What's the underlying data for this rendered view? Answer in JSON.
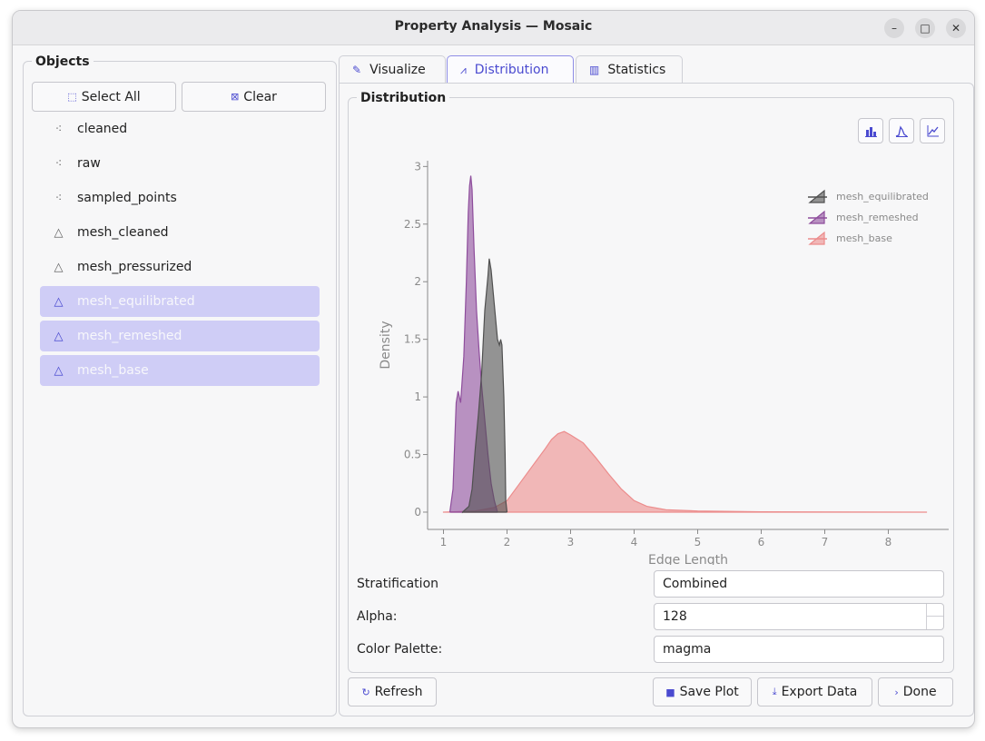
{
  "window": {
    "title": "Property Analysis — Mosaic",
    "controls": [
      "–",
      "□",
      "✕"
    ]
  },
  "objects_panel": {
    "title": "Objects",
    "select_all_label": "Select All",
    "clear_label": "Clear",
    "items": [
      {
        "label": "cleaned",
        "icon": "point-cloud-icon",
        "selected": false
      },
      {
        "label": "raw",
        "icon": "point-cloud-icon",
        "selected": false
      },
      {
        "label": "sampled_points",
        "icon": "point-cloud-icon",
        "selected": false
      },
      {
        "label": "mesh_cleaned",
        "icon": "triangle-mesh-icon",
        "selected": false
      },
      {
        "label": "mesh_pressurized",
        "icon": "triangle-mesh-icon",
        "selected": false
      },
      {
        "label": "mesh_equilibrated",
        "icon": "triangle-mesh-icon",
        "selected": true
      },
      {
        "label": "mesh_remeshed",
        "icon": "triangle-mesh-icon",
        "selected": true
      },
      {
        "label": "mesh_base",
        "icon": "triangle-mesh-icon",
        "selected": true
      }
    ]
  },
  "tabs": [
    {
      "label": "Visualize",
      "icon": "brush-icon",
      "active": false
    },
    {
      "label": "Distribution",
      "icon": "distribution-icon",
      "active": true
    },
    {
      "label": "Statistics",
      "icon": "bar-chart-icon",
      "active": false
    }
  ],
  "distribution_group": {
    "title": "Distribution",
    "tools": [
      "histogram-icon",
      "density-icon",
      "line-plot-icon"
    ]
  },
  "chart_data": {
    "type": "area",
    "xlabel": "Edge Length",
    "ylabel": "Density",
    "xlim": [
      0.75,
      8.95
    ],
    "ylim": [
      -0.15,
      3.05
    ],
    "x_ticks": [
      1,
      2,
      3,
      4,
      5,
      6,
      7,
      8
    ],
    "y_ticks": [
      0,
      0.5,
      1,
      1.5,
      2,
      2.5,
      3
    ],
    "legend_position": "top-right",
    "grid": false,
    "series": [
      {
        "name": "mesh_equilibrated",
        "color": "#505050",
        "points": [
          [
            1.3,
            0
          ],
          [
            1.4,
            0.05
          ],
          [
            1.45,
            0.2
          ],
          [
            1.5,
            0.55
          ],
          [
            1.55,
            0.85
          ],
          [
            1.6,
            1.2
          ],
          [
            1.65,
            1.75
          ],
          [
            1.7,
            2.05
          ],
          [
            1.72,
            2.2
          ],
          [
            1.75,
            2.1
          ],
          [
            1.8,
            1.8
          ],
          [
            1.85,
            1.5
          ],
          [
            1.88,
            1.45
          ],
          [
            1.9,
            1.5
          ],
          [
            1.92,
            1.45
          ],
          [
            1.95,
            1.0
          ],
          [
            1.97,
            0.5
          ],
          [
            1.98,
            0.1
          ],
          [
            2.0,
            0
          ]
        ]
      },
      {
        "name": "mesh_remeshed",
        "color": "#8e4d9c",
        "points": [
          [
            1.1,
            0
          ],
          [
            1.15,
            0.2
          ],
          [
            1.18,
            0.65
          ],
          [
            1.2,
            0.95
          ],
          [
            1.23,
            1.05
          ],
          [
            1.27,
            0.95
          ],
          [
            1.32,
            1.35
          ],
          [
            1.36,
            2.0
          ],
          [
            1.39,
            2.6
          ],
          [
            1.41,
            2.83
          ],
          [
            1.43,
            2.92
          ],
          [
            1.45,
            2.8
          ],
          [
            1.48,
            2.3
          ],
          [
            1.52,
            1.75
          ],
          [
            1.56,
            1.4
          ],
          [
            1.6,
            1.1
          ],
          [
            1.65,
            0.8
          ],
          [
            1.7,
            0.5
          ],
          [
            1.75,
            0.25
          ],
          [
            1.8,
            0.1
          ],
          [
            1.85,
            0
          ]
        ]
      },
      {
        "name": "mesh_base",
        "color": "#ec8c8c",
        "points": [
          [
            1.0,
            0
          ],
          [
            1.5,
            0.01
          ],
          [
            1.8,
            0.04
          ],
          [
            2.0,
            0.1
          ],
          [
            2.2,
            0.25
          ],
          [
            2.4,
            0.4
          ],
          [
            2.6,
            0.55
          ],
          [
            2.7,
            0.63
          ],
          [
            2.8,
            0.68
          ],
          [
            2.9,
            0.7
          ],
          [
            3.0,
            0.67
          ],
          [
            3.2,
            0.6
          ],
          [
            3.4,
            0.47
          ],
          [
            3.6,
            0.33
          ],
          [
            3.8,
            0.2
          ],
          [
            4.0,
            0.1
          ],
          [
            4.2,
            0.05
          ],
          [
            4.5,
            0.02
          ],
          [
            5.0,
            0.01
          ],
          [
            6.0,
            0.003
          ],
          [
            8.6,
            0
          ]
        ]
      }
    ]
  },
  "controls": {
    "stratification_label": "Stratification",
    "stratification_value": "Combined",
    "alpha_label": "Alpha:",
    "alpha_value": "128",
    "palette_label": "Color Palette:",
    "palette_value": "magma"
  },
  "footer": {
    "refresh_label": "Refresh",
    "save_plot_label": "Save Plot",
    "export_data_label": "Export Data",
    "done_label": "Done"
  }
}
